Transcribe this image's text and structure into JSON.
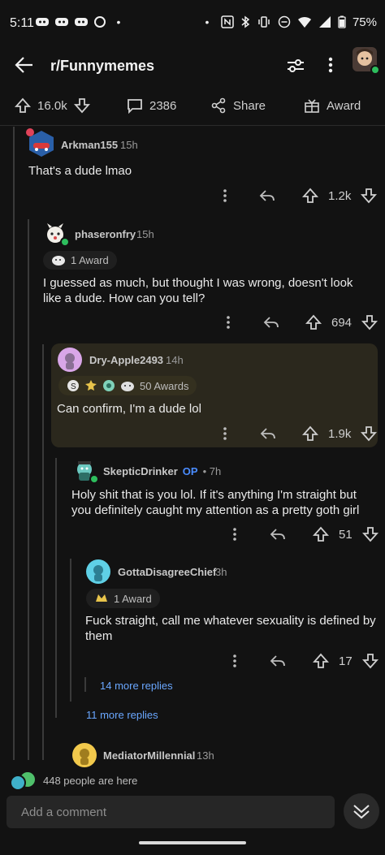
{
  "status": {
    "time": "5:11",
    "battery": "75%"
  },
  "header": {
    "title": "r/Funnymemes"
  },
  "post_actions": {
    "votes": "16.0k",
    "comments": "2386",
    "share": "Share",
    "award": "Award"
  },
  "comments": [
    {
      "user": "Arkman155",
      "time": "15h",
      "text": "That's a dude lmao",
      "votes": "1.2k"
    },
    {
      "user": "phaseronfry",
      "time": "15h",
      "award": "1 Award",
      "text": "I guessed as much, but thought I was wrong, doesn't look like a dude. How can you tell?",
      "votes": "694"
    },
    {
      "user": "Dry-Apple2493",
      "time": "14h",
      "award": "50 Awards",
      "text": "Can confirm, I'm a dude lol",
      "votes": "1.9k"
    },
    {
      "user": "SkepticDrinker",
      "op": "OP",
      "time": "• 7h",
      "text": "Holy shit that is you lol. If it's anything I'm straight but you definitely caught my attention as a pretty goth girl",
      "votes": "51"
    },
    {
      "user": "GottaDisagreeChief",
      "time": "3h",
      "award": "1 Award",
      "text": "Fuck straight, call me whatever sexuality is defined by them",
      "votes": "17"
    },
    {
      "user": "MediatorMillennial",
      "time": "13h"
    }
  ],
  "more_replies": {
    "inner": "14 more replies",
    "outer": "11 more replies"
  },
  "bottom": {
    "presence": "448 people are here",
    "comment_placeholder": "Add a comment"
  }
}
